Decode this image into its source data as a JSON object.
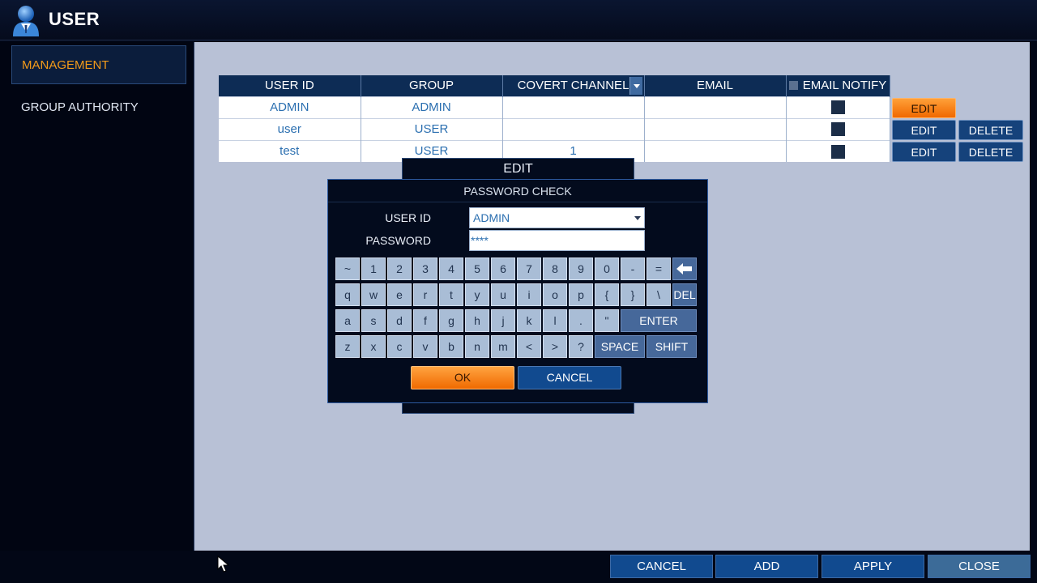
{
  "header": {
    "title": "USER",
    "icon": "user-icon"
  },
  "sidebar": {
    "items": [
      {
        "label": "MANAGEMENT",
        "active": true
      },
      {
        "label": "GROUP AUTHORITY",
        "active": false
      }
    ]
  },
  "table": {
    "headers": [
      "USER ID",
      "GROUP",
      "COVERT CHANNEL",
      "EMAIL",
      "EMAIL NOTIFY"
    ],
    "rows": [
      {
        "user_id": "ADMIN",
        "group": "ADMIN",
        "covert": "",
        "email": "",
        "edit": "EDIT",
        "delete": ""
      },
      {
        "user_id": "user",
        "group": "USER",
        "covert": "",
        "email": "",
        "edit": "EDIT",
        "delete": "DELETE"
      },
      {
        "user_id": "test",
        "group": "USER",
        "covert": "1",
        "email": "",
        "edit": "EDIT",
        "delete": "DELETE"
      }
    ]
  },
  "edit_dialog": {
    "title": "EDIT"
  },
  "password_dialog": {
    "title": "PASSWORD CHECK",
    "user_id_label": "USER ID",
    "user_id_value": "ADMIN",
    "password_label": "PASSWORD",
    "password_value": "****",
    "ok": "OK",
    "cancel": "CANCEL"
  },
  "keyboard": {
    "row1": [
      "~",
      "1",
      "2",
      "3",
      "4",
      "5",
      "6",
      "7",
      "8",
      "9",
      "0",
      "-",
      "="
    ],
    "row2": [
      "q",
      "w",
      "e",
      "r",
      "t",
      "y",
      "u",
      "i",
      "o",
      "p",
      "{",
      "}",
      "\\"
    ],
    "row3": [
      "a",
      "s",
      "d",
      "f",
      "g",
      "h",
      "j",
      "k",
      "l",
      ".",
      "\""
    ],
    "row4": [
      "z",
      "x",
      "c",
      "v",
      "b",
      "n",
      "m",
      "<",
      ">",
      "?"
    ],
    "backspace_icon": "backspace-arrow-icon",
    "del": "DEL",
    "enter": "ENTER",
    "space": "SPACE",
    "shift": "SHIFT"
  },
  "footer": {
    "cancel": "CANCEL",
    "add": "ADD",
    "apply": "APPLY",
    "close": "CLOSE"
  },
  "colors": {
    "accent": "#f29a1a",
    "panel": "#b8c1d6",
    "button": "#114a8f",
    "header": "#0d2c55"
  }
}
